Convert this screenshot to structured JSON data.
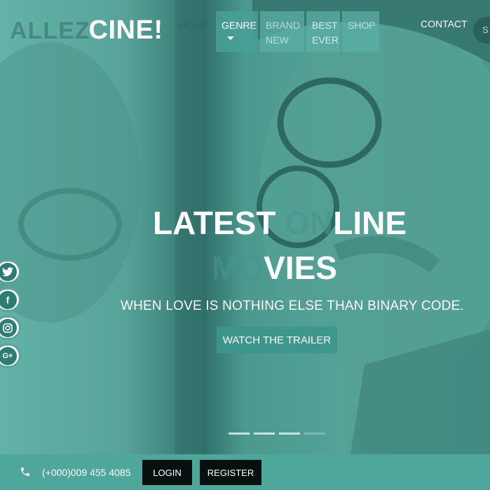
{
  "header": {
    "logo_ghost": "ALLEZ",
    "logo_main": "CINE!",
    "nav": [
      {
        "label": "HOME"
      },
      {
        "label": "GENRE"
      },
      {
        "label": "BRAND NEW"
      },
      {
        "label": "BEST EVER"
      },
      {
        "label": "SHOP"
      }
    ],
    "contact": "CONTACT",
    "search_fragment": "S"
  },
  "hero": {
    "headline_1a": "LATEST ",
    "headline_1b": "ON",
    "headline_1c": "LINE",
    "headline_2a": "MO",
    "headline_2b": "VIES",
    "tagline": "WHEN LOVE IS NOTHING ELSE THAN BINARY CODE.",
    "cta": "WATCH THE TRAILER",
    "slides": 4,
    "active_slides": 3
  },
  "social": [
    {
      "icon": "twitter-icon"
    },
    {
      "icon": "facebook-icon"
    },
    {
      "icon": "instagram-icon"
    },
    {
      "icon": "google-plus-icon"
    }
  ],
  "footer": {
    "phone": "(+000)009 455 4085",
    "login": "LOGIN",
    "register": "REGISTER"
  },
  "colors": {
    "accent": "#4fa79b",
    "dark_button": "#06110f"
  }
}
